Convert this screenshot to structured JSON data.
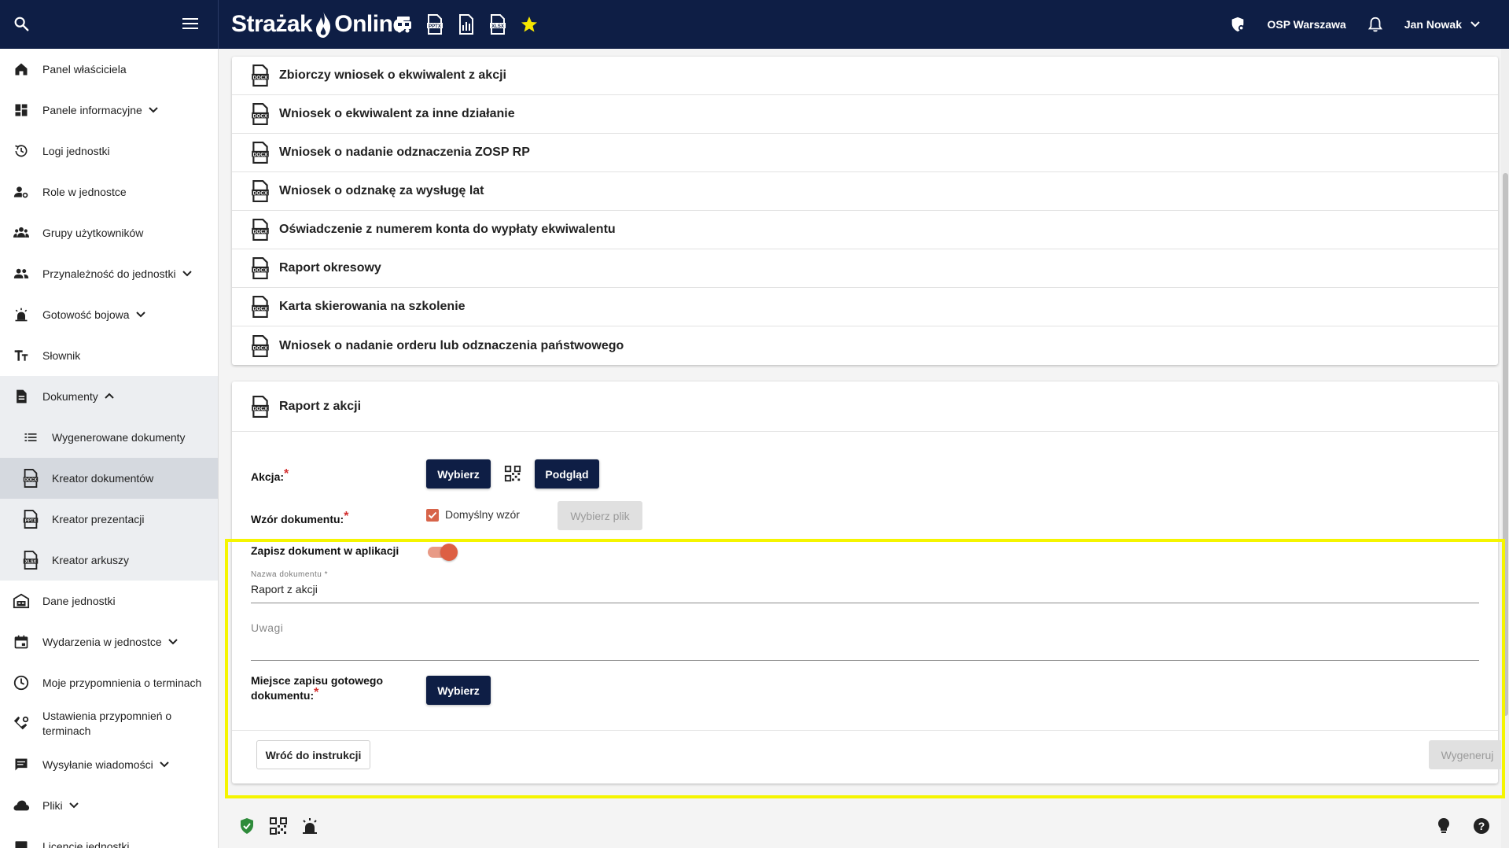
{
  "topbar": {
    "brand_left": "Strażak",
    "brand_right": "Online",
    "quick_icons": [
      "fire-truck-icon",
      "pptx-file-icon",
      "report-icon",
      "xlsx-file-icon",
      "star-icon"
    ],
    "unit_name": "OSP Warszawa",
    "user_name": "Jan Nowak",
    "accent_color": "#f5e600"
  },
  "sidebar": {
    "items": [
      {
        "label": "Panel właściciela",
        "icon": "home-icon"
      },
      {
        "label": "Panele informacyjne",
        "icon": "dashboard-icon",
        "caret": "down"
      },
      {
        "label": "Logi jednostki",
        "icon": "history-icon"
      },
      {
        "label": "Role w jednostce",
        "icon": "user-settings-icon"
      },
      {
        "label": "Grupy użytkowników",
        "icon": "groups-icon"
      },
      {
        "label": "Przynależność do jednostki",
        "icon": "people-icon",
        "caret": "down"
      },
      {
        "label": "Gotowość bojowa",
        "icon": "alarm-light-icon",
        "caret": "down"
      },
      {
        "label": "Słownik",
        "icon": "text-size-icon"
      },
      {
        "label": "Dokumenty",
        "icon": "document-icon",
        "caret": "up"
      },
      {
        "label": "Wygenerowane dokumenty",
        "icon": "list-icon"
      },
      {
        "label": "Kreator dokumentów",
        "icon": "docx-icon"
      },
      {
        "label": "Kreator prezentacji",
        "icon": "pptx-icon"
      },
      {
        "label": "Kreator arkuszy",
        "icon": "xlsx-icon"
      },
      {
        "label": "Dane jednostki",
        "icon": "fire-station-icon"
      },
      {
        "label": "Wydarzenia w jednostce",
        "icon": "calendar-icon",
        "caret": "down"
      },
      {
        "label": "Moje przypomnienia o terminach",
        "icon": "clock-icon"
      },
      {
        "label": "Ustawienia przypomnień o terminach",
        "icon": "reminder-settings-icon"
      },
      {
        "label": "Wysyłanie wiadomości",
        "icon": "message-icon",
        "caret": "down"
      },
      {
        "label": "Pliki",
        "icon": "cloud-icon",
        "caret": "down"
      },
      {
        "label": "Licencje jednostki",
        "icon": "license-icon"
      }
    ]
  },
  "documents": [
    "Zbiorczy wniosek o ekwiwalent z akcji",
    "Wniosek o ekwiwalent za inne działanie",
    "Wniosek o nadanie odznaczenia ZOSP RP",
    "Wniosek o odznakę za wysługę lat",
    "Oświadczenie z numerem konta do wypłaty ekwiwalentu",
    "Raport okresowy",
    "Karta skierowania na szkolenie",
    "Wniosek o nadanie orderu lub odznaczenia państwowego"
  ],
  "form": {
    "title": "Raport z akcji",
    "action_label": "Akcja:",
    "select_button": "Wybierz",
    "preview_button": "Podgląd",
    "template_label": "Wzór dokumentu:",
    "default_template_label": "Domyślny wzór",
    "default_template_checked": true,
    "choose_file_button": "Wybierz plik",
    "save_label": "Zapisz dokument w aplikacji",
    "save_enabled": true,
    "name_field_label": "Nazwa dokumentu *",
    "name_field_value": "Raport z akcji",
    "notes_placeholder": "Uwagi",
    "location_label_1": "Miejsce zapisu gotowego",
    "location_label_2": "dokumentu:",
    "location_button": "Wybierz",
    "back_button": "Wróć do instrukcji",
    "generate_button": "Wygeneruj",
    "required_mark": "*"
  },
  "bottom_icons": [
    "shield-check-icon",
    "qr-code-icon",
    "alarm-light-icon",
    "lightbulb-icon",
    "help-icon"
  ]
}
